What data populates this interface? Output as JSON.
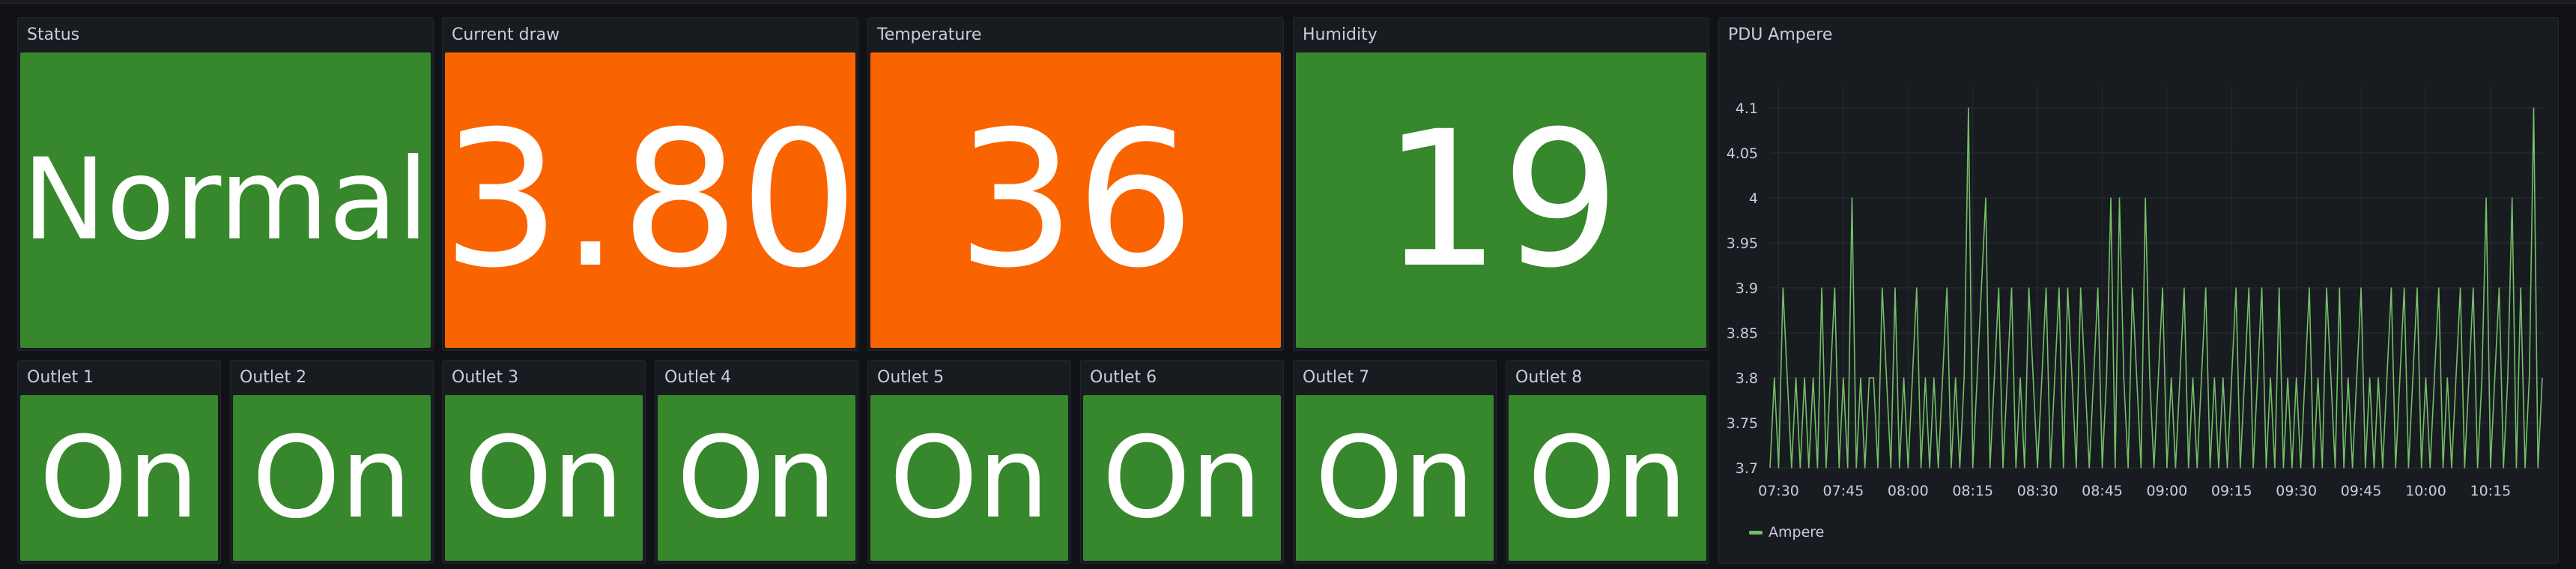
{
  "colors": {
    "green": "#37872d",
    "orange": "#fa6400",
    "panel_bg": "#181b1f",
    "line": "#73bf69"
  },
  "panels": {
    "status": {
      "title": "Status",
      "value": "Normal",
      "color": "green"
    },
    "current_draw": {
      "title": "Current draw",
      "value": "3.80",
      "color": "orange"
    },
    "temperature": {
      "title": "Temperature",
      "value": "36",
      "color": "orange"
    },
    "humidity": {
      "title": "Humidity",
      "value": "19",
      "color": "green"
    }
  },
  "outlets": [
    {
      "title": "Outlet 1",
      "value": "On"
    },
    {
      "title": "Outlet 2",
      "value": "On"
    },
    {
      "title": "Outlet 3",
      "value": "On"
    },
    {
      "title": "Outlet 4",
      "value": "On"
    },
    {
      "title": "Outlet 5",
      "value": "On"
    },
    {
      "title": "Outlet 6",
      "value": "On"
    },
    {
      "title": "Outlet 7",
      "value": "On"
    },
    {
      "title": "Outlet 8",
      "value": "On"
    }
  ],
  "chart_panel": {
    "title": "PDU Ampere"
  },
  "chart_data": {
    "type": "line",
    "title": "PDU Ampere",
    "xlabel": "",
    "ylabel": "",
    "x_ticks": [
      "07:30",
      "07:45",
      "08:00",
      "08:15",
      "08:30",
      "08:45",
      "09:00",
      "09:15",
      "09:30",
      "09:45",
      "10:00",
      "10:15"
    ],
    "y_ticks": [
      "3.7",
      "3.75",
      "3.8",
      "3.85",
      "3.9",
      "3.95",
      "4",
      "4.05",
      "4.1"
    ],
    "xlim": [
      "07:28",
      "10:27"
    ],
    "ylim": [
      3.7,
      4.1
    ],
    "grid": true,
    "legend_position": "bottom-left",
    "series": [
      {
        "name": "Ampere",
        "color": "#73bf69",
        "sample_interval_minutes": 1,
        "start": "07:28",
        "values": [
          3.7,
          3.8,
          3.7,
          3.9,
          3.8,
          3.7,
          3.8,
          3.7,
          3.8,
          3.7,
          3.8,
          3.7,
          3.9,
          3.7,
          3.8,
          3.9,
          3.7,
          3.8,
          3.7,
          4.0,
          3.7,
          3.8,
          3.7,
          3.8,
          3.8,
          3.7,
          3.9,
          3.8,
          3.7,
          3.9,
          3.7,
          3.8,
          3.7,
          3.8,
          3.9,
          3.7,
          3.8,
          3.7,
          3.8,
          3.7,
          3.8,
          3.9,
          3.7,
          3.8,
          3.7,
          3.8,
          4.1,
          3.7,
          3.8,
          3.9,
          4.0,
          3.7,
          3.8,
          3.9,
          3.7,
          3.8,
          3.9,
          3.7,
          3.8,
          3.7,
          3.9,
          3.8,
          3.7,
          3.8,
          3.9,
          3.7,
          3.8,
          3.9,
          3.7,
          3.9,
          3.8,
          3.7,
          3.9,
          3.8,
          3.7,
          3.8,
          3.9,
          3.7,
          3.8,
          4.0,
          3.7,
          4.0,
          3.8,
          3.7,
          3.9,
          3.8,
          3.7,
          4.0,
          3.8,
          3.7,
          3.8,
          3.9,
          3.7,
          3.8,
          3.7,
          3.8,
          3.9,
          3.7,
          3.8,
          3.7,
          3.8,
          3.9,
          3.7,
          3.8,
          3.7,
          3.8,
          3.7,
          3.8,
          3.9,
          3.7,
          3.8,
          3.9,
          3.7,
          3.8,
          3.9,
          3.7,
          3.8,
          3.7,
          3.9,
          3.7,
          3.8,
          3.7,
          3.8,
          3.7,
          3.8,
          3.9,
          3.7,
          3.8,
          3.7,
          3.9,
          3.8,
          3.7,
          3.9,
          3.7,
          3.8,
          3.7,
          3.8,
          3.9,
          3.7,
          3.8,
          3.7,
          3.8,
          3.7,
          3.8,
          3.9,
          3.7,
          3.8,
          3.9,
          3.7,
          3.8,
          3.9,
          3.7,
          3.8,
          3.7,
          3.8,
          3.9,
          3.7,
          3.8,
          3.7,
          3.8,
          3.9,
          3.7,
          3.8,
          3.9,
          3.7,
          3.8,
          4.0,
          3.7,
          3.8,
          3.9,
          3.7,
          3.8,
          4.0,
          3.7,
          3.9,
          3.7,
          3.8,
          4.1,
          3.7,
          3.8
        ]
      }
    ]
  }
}
